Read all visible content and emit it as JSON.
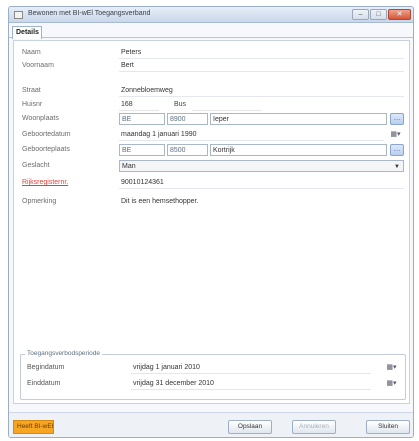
{
  "window": {
    "title": "Bewonen met BI-wEl Toegangsverband",
    "controls": [
      "–",
      "□",
      "✕"
    ]
  },
  "tabs": [
    {
      "label": "Details"
    }
  ],
  "form": {
    "naam": {
      "label": "Naam",
      "value": "Peters"
    },
    "voornaam": {
      "label": "Voornaam",
      "value": "Bert"
    },
    "straat": {
      "label": "Straat",
      "value": "Zonnebloemweg"
    },
    "huisnr": {
      "label": "Huisnr",
      "value": "168",
      "bus_label": "Bus",
      "bus_value": ""
    },
    "woonplaats": {
      "label": "Woonplaats",
      "country": "BE",
      "postcode": "8900",
      "city": "Ieper"
    },
    "geboortedatum": {
      "label": "Geboortedatum",
      "value": "maandag 1 januari 1990"
    },
    "geboorteplaats": {
      "label": "Geboorteplaats",
      "country": "BE",
      "postcode": "8500",
      "city": "Kortrijk"
    },
    "geslacht": {
      "label": "Geslacht",
      "value": "Man"
    },
    "rijksregisternr": {
      "label": "Rijksregisternr.",
      "value": "90010124361"
    },
    "opmerking": {
      "label": "Opmerking",
      "value": "Dit is een hemsethopper."
    }
  },
  "toegangsperiode": {
    "legend": "Toegangsverbodsperiode",
    "begin": {
      "label": "Begindatum",
      "value": "vrijdag 1 januari 2010"
    },
    "eind": {
      "label": "Einddatum",
      "value": "vrijdag 31 december 2010"
    }
  },
  "footer": {
    "status_label": "Heeft BI-wEl",
    "opslaan": "Opslaan",
    "annuleren": "Annuleren",
    "sluiten": "Sluiten"
  },
  "icons": {
    "lookup": "ellipsis-button-icon",
    "calendar": "calendar-dropdown-icon",
    "dropdown": "chevron-down-icon"
  }
}
